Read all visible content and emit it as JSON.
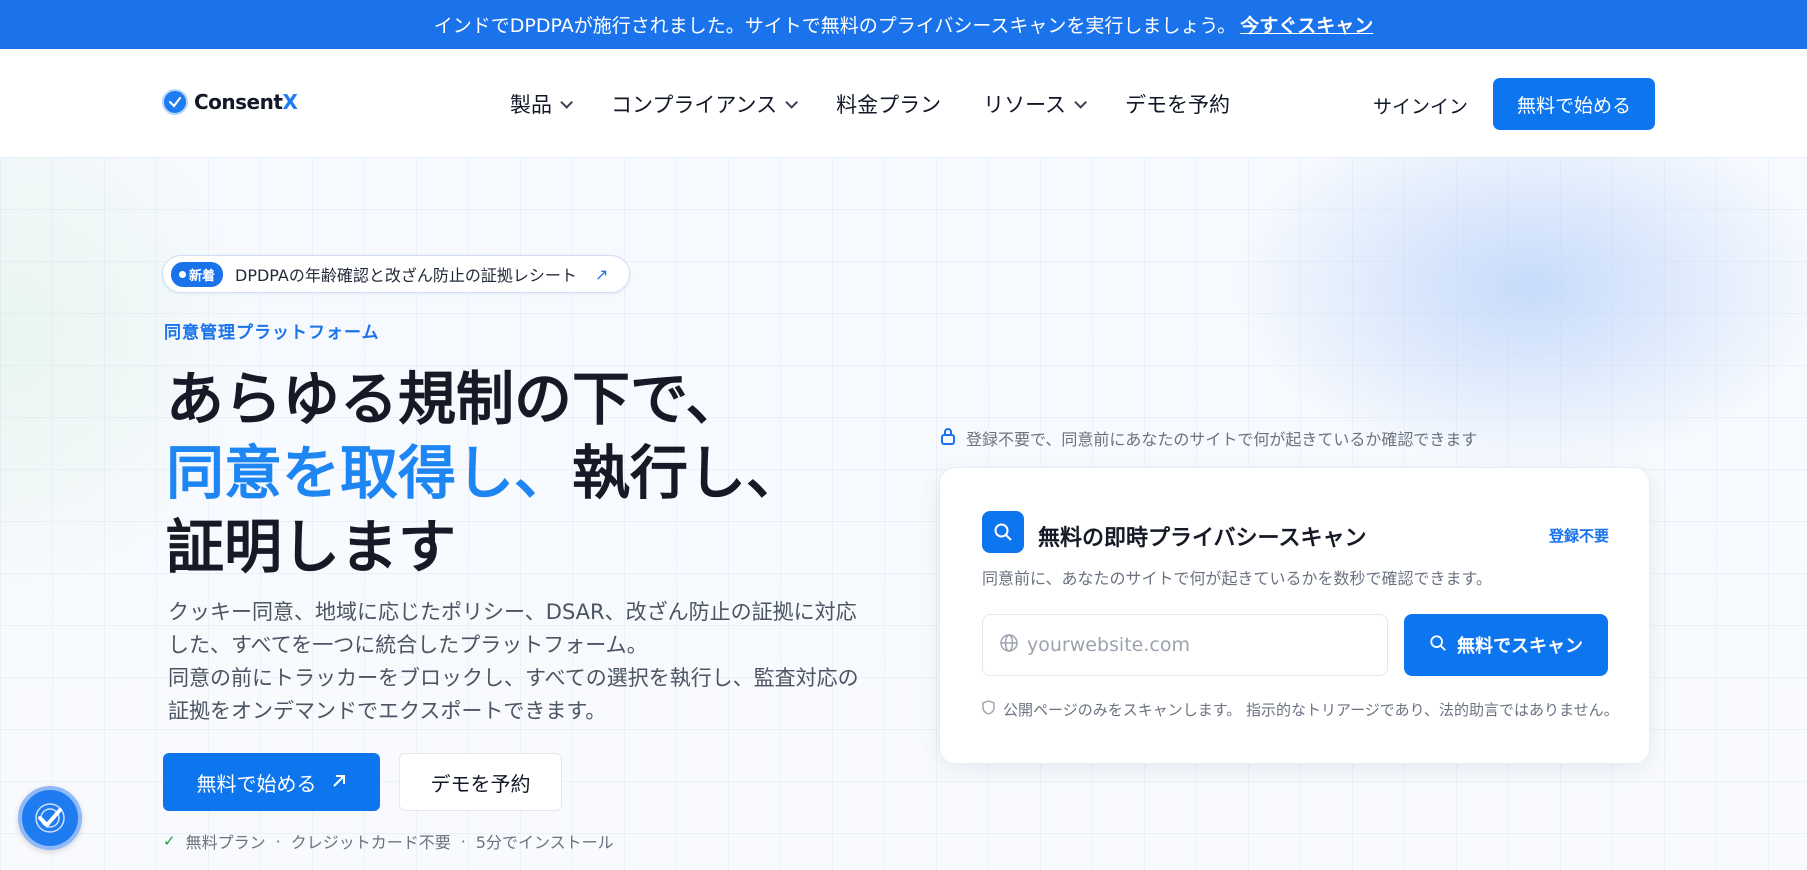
{
  "colors": {
    "primary": "#0d76ef",
    "accent_text": "#1e86f2",
    "announce_bg": "#1a73ea"
  },
  "announcement": {
    "text": "インドでDPDPAが施行されました。サイトで無料のプライバシースキャンを実行しましょう。",
    "link": "今すぐスキャン"
  },
  "header": {
    "logo": "ConsentX",
    "nav": [
      "製品",
      "コンプライアンス",
      "料金プラン",
      "リソース",
      "デモを予約"
    ],
    "signin": "サインイン",
    "start_button": "無料で始める"
  },
  "hero": {
    "badge": "新着",
    "badge_text": "DPDPAの年齢確認と改ざん防止の証拠レシート",
    "eyebrow": "同意管理プラットフォーム",
    "headline_line1": "あらゆる規制の下で、",
    "headline_blue": "同意を取得し、",
    "headline_line2_rest": "執行し、",
    "headline_line3": "証明します",
    "desc_line1": "クッキー同意、地域に応じたポリシー、DSAR、改ざん防止の証拠に対応",
    "desc_line2": "した、すべてを一つに統合したプラットフォーム。",
    "desc_line3": "同意の前にトラッカーをブロックし、すべての選択を執行し、監査対応の",
    "desc_line4": "証拠をオンデマンドでエクスポートできます。",
    "cta_primary": "無料で始める",
    "cta_secondary": "デモを予約",
    "perks": [
      "無料プラン",
      "クレジットカード不要",
      "5分でインストール"
    ]
  },
  "scan": {
    "note": "登録不要で、同意前にあなたのサイトで何が起きているか確認できます",
    "title": "無料の即時プライバシースキャン",
    "tag": "登録不要",
    "subtitle": "同意前に、あなたのサイトで何が起きているかを数秒で確認できます。",
    "placeholder": "yourwebsite.com",
    "button": "無料でスキャン",
    "footnote": "公開ページのみをスキャンします。 指示的なトリアージであり、法的助言ではありません。"
  }
}
